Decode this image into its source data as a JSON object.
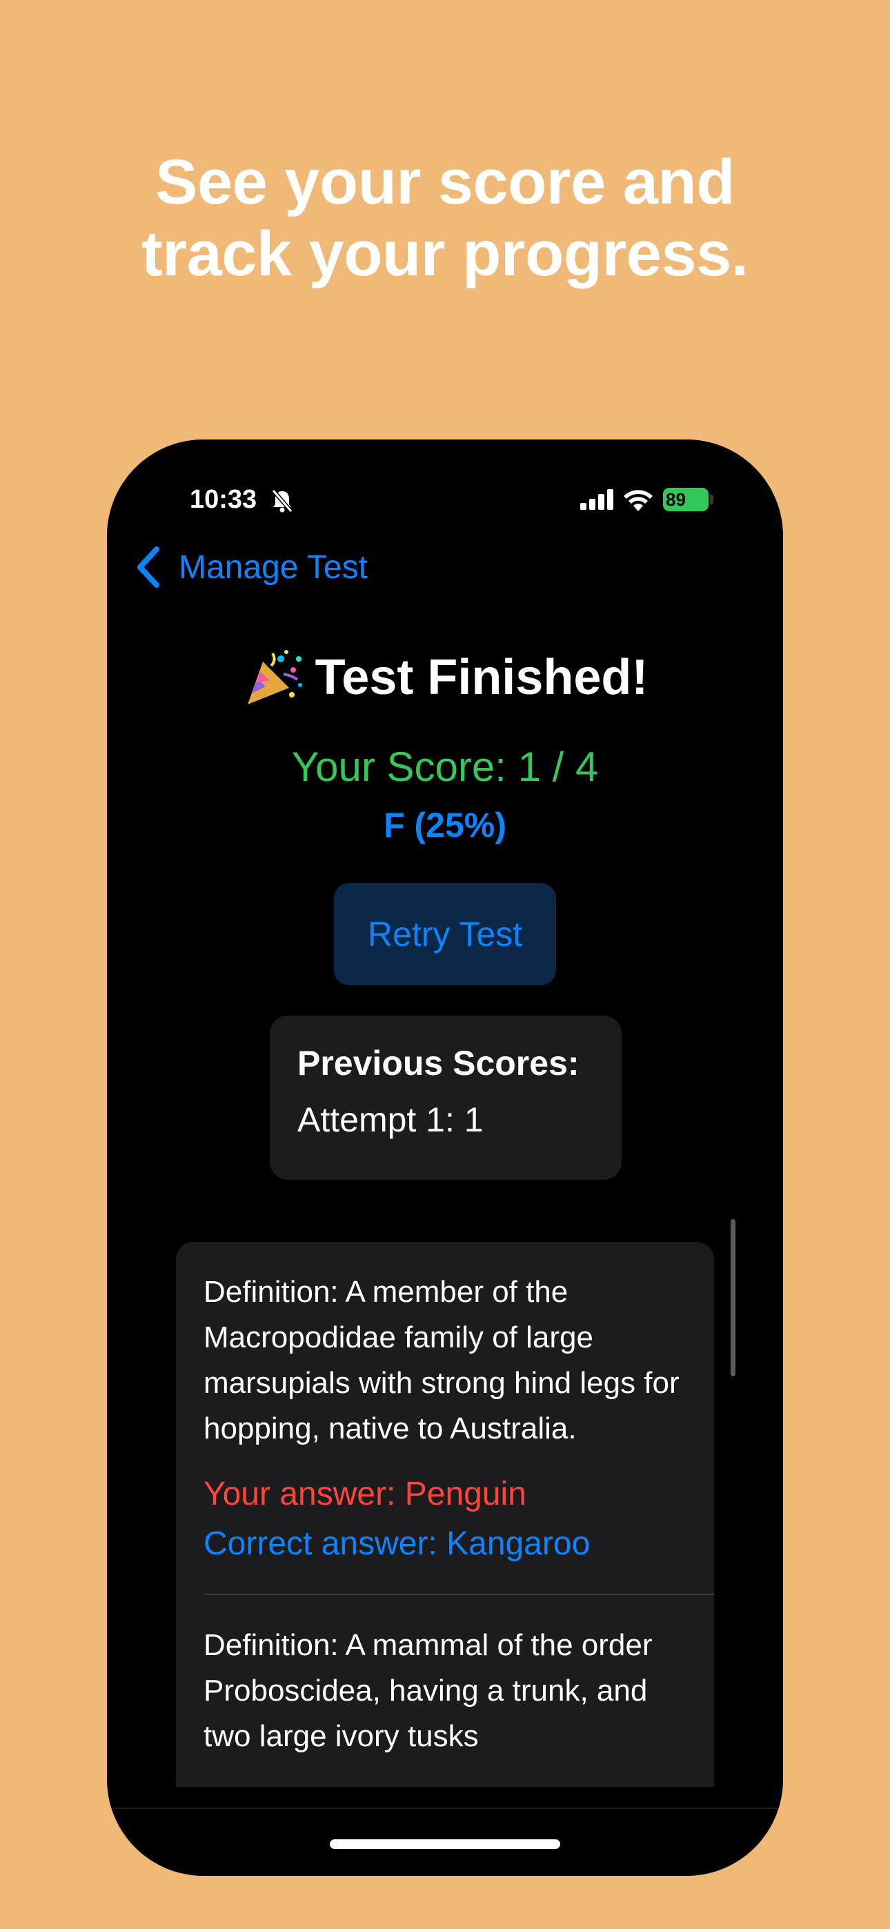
{
  "headline": {
    "line1": "See your score and",
    "line2": "track your progress."
  },
  "status_bar": {
    "time": "10:33",
    "battery": "89"
  },
  "nav": {
    "back_label": "Manage Test"
  },
  "title": "Test Finished!",
  "score_text": "Your Score: 1 / 4",
  "grade_text": "F (25%)",
  "retry_label": "Retry Test",
  "previous_scores": {
    "title": "Previous Scores:",
    "items": [
      "Attempt 1: 1"
    ]
  },
  "results": [
    {
      "definition": "Definition: A member of the Macropodidae family of large marsupials with strong hind legs for hopping, native to Australia.",
      "your_answer": "Your answer: Penguin",
      "correct_answer": "Correct answer: Kangaroo"
    },
    {
      "definition": "Definition: A mammal of the order Proboscidea, having a trunk, and two large ivory tusks"
    }
  ],
  "colors": {
    "background": "#F0B978",
    "accent_blue": "#0A84FF",
    "score_green": "#34C759",
    "wrong_red": "#FF453A",
    "card": "#1C1C1E"
  },
  "icons": {
    "back": "chevron-left-icon",
    "bell": "bell-slash-icon",
    "signal": "cellular-signal-icon",
    "wifi": "wifi-icon",
    "party": "party-popper-icon"
  }
}
